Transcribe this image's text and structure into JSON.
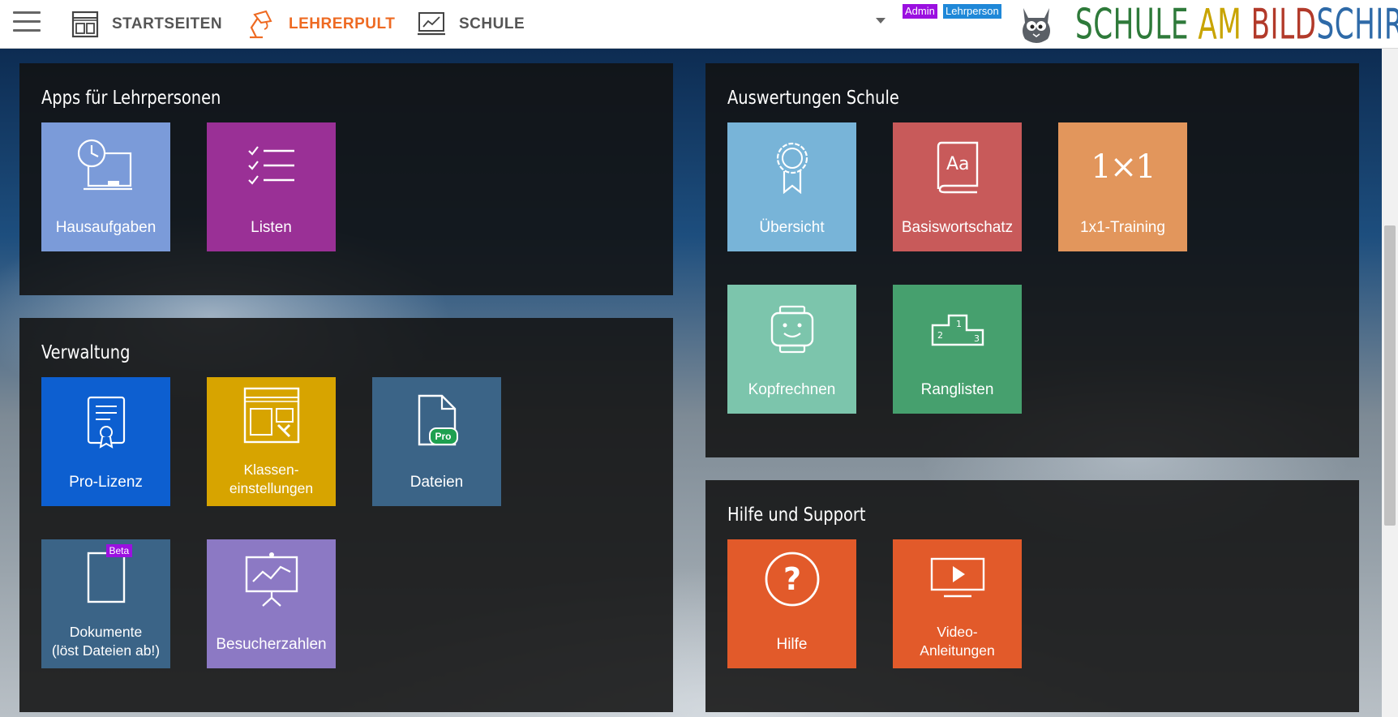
{
  "nav": {
    "items": [
      {
        "label": "STARTSEITEN"
      },
      {
        "label": "LEHRERPULT"
      },
      {
        "label": "SCHULE"
      }
    ],
    "badges": {
      "admin": "Admin",
      "teacher": "Lehrperson"
    },
    "logo": {
      "w1": "SCHULE",
      "w2": "AM",
      "w3": "BILD",
      "w4": "SCHIRM",
      "mark": "[x]"
    }
  },
  "panels": {
    "apps": {
      "title": "Apps für Lehrpersonen",
      "tiles": [
        {
          "label": "Hausaufgaben",
          "icon": "homework-clock-icon",
          "color": "#7b9bd9"
        },
        {
          "label": "Listen",
          "icon": "checklist-icon",
          "color": "#9a3096"
        }
      ]
    },
    "verwaltung": {
      "title": "Verwaltung",
      "tiles": [
        {
          "label": "Pro-Lizenz",
          "icon": "certificate-icon",
          "color": "#0d5fd0"
        },
        {
          "label_line1": "Klassen-",
          "label_line2": "einstellungen",
          "icon": "window-settings-icon",
          "color": "#d7a400"
        },
        {
          "label": "Dateien",
          "icon": "file-icon",
          "color": "#3b6487",
          "badge": "Pro"
        },
        {
          "label_line1": "Dokumente",
          "label_line2": "(löst Dateien ab!)",
          "icon": "document-icon",
          "color": "#3b6487",
          "badge": "Beta"
        },
        {
          "label": "Besucherzahlen",
          "icon": "presentation-chart-icon",
          "color": "#8c79c4"
        }
      ]
    },
    "auswertungen": {
      "title": "Auswertungen Schule",
      "tiles": [
        {
          "label": "Übersicht",
          "icon": "award-ribbon-icon",
          "color": "#78b4d8"
        },
        {
          "label": "Basiswortschatz",
          "icon": "dictionary-book-icon",
          "color": "#c85a5a"
        },
        {
          "label": "1x1-Training",
          "icon": "multiplication-icon",
          "color": "#e2965c",
          "glyph": "1×1"
        },
        {
          "label": "Kopfrechnen",
          "icon": "robot-face-icon",
          "color": "#7cc5ac"
        },
        {
          "label": "Ranglisten",
          "icon": "podium-icon",
          "color": "#46a06e"
        }
      ]
    },
    "hilfe": {
      "title": "Hilfe und Support",
      "tiles": [
        {
          "label": "Hilfe",
          "icon": "help-question-icon",
          "color": "#e25a2a"
        },
        {
          "label_line1": "Video-",
          "label_line2": "Anleitungen",
          "icon": "video-play-icon",
          "color": "#e25a2a"
        }
      ]
    }
  }
}
